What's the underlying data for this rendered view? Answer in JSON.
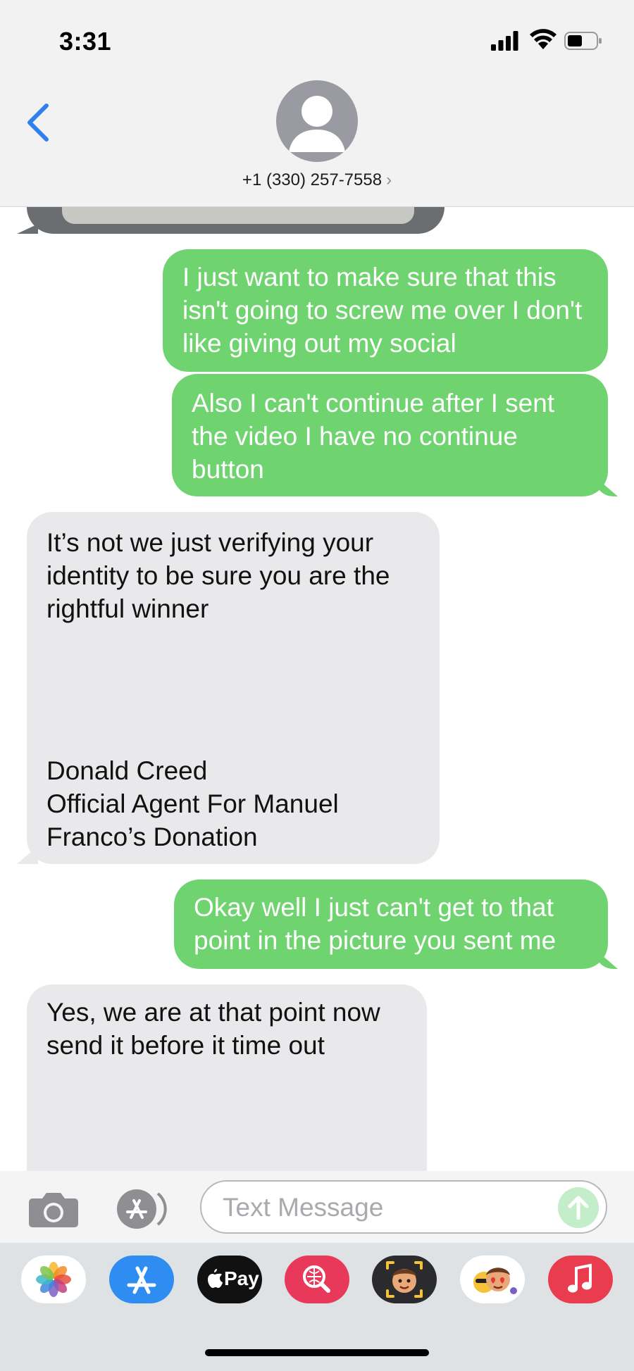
{
  "status_bar": {
    "time": "3:31"
  },
  "header": {
    "contact": "+1 (330) 257-7558",
    "chevron": "›"
  },
  "messages": [
    {
      "direction": "sent",
      "text": "I just want to make sure that this isn't going to screw me over I don't like giving out my social"
    },
    {
      "direction": "sent",
      "text": "Also I can't continue after I sent the video I have no continue button"
    },
    {
      "direction": "received",
      "text": "It’s not we just verifying your identity to be sure you are the rightful winner",
      "signature": [
        "Donald Creed",
        "Official Agent For Manuel",
        "Franco’s Donation"
      ]
    },
    {
      "direction": "sent",
      "text": "Okay well I just can't get to that point in the picture you sent me"
    },
    {
      "direction": "received",
      "text": "Yes, we are at that point now send it before it time out"
    }
  ],
  "input": {
    "placeholder": "Text Message"
  },
  "app_tray": {
    "apple_pay_label": "Pay",
    "apps": [
      "photos-icon",
      "app-store-icon",
      "apple-pay-icon",
      "image-search-icon",
      "memoji-icon",
      "animoji-stickers-icon",
      "music-icon"
    ]
  },
  "colors": {
    "sent_bubble": "#6fd46f",
    "received_bubble": "#e9e9eb",
    "accent_blue": "#2f80ed"
  }
}
